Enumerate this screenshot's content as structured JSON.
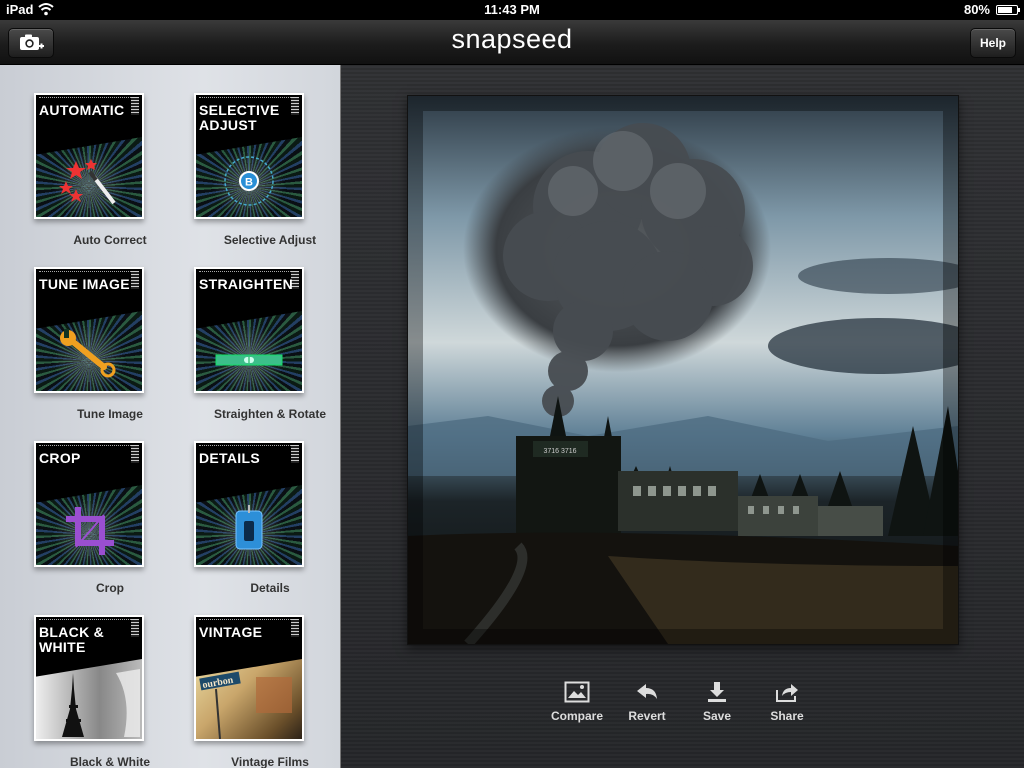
{
  "status": {
    "carrier": "iPad",
    "time": "11:43 PM",
    "battery_pct": "80%",
    "battery_level": 0.8
  },
  "nav": {
    "logo": "snapseed",
    "help_label": "Help"
  },
  "tools": [
    {
      "tile": "AUTOMATIC",
      "label": "Auto Correct",
      "icon": "magic-wand-icon"
    },
    {
      "tile": "SELECTIVE\nADJUST",
      "label": "Selective Adjust",
      "icon": "control-point-icon"
    },
    {
      "tile": "TUNE IMAGE",
      "label": "Tune Image",
      "icon": "wrench-icon"
    },
    {
      "tile": "STRAIGHTEN",
      "label": "Straighten & Rotate",
      "icon": "level-icon"
    },
    {
      "tile": "CROP",
      "label": "Crop",
      "icon": "crop-icon"
    },
    {
      "tile": "DETAILS",
      "label": "Details",
      "icon": "sharpener-icon"
    },
    {
      "tile": "BLACK &\nWHITE",
      "label": "Black & White",
      "icon": "eiffel-tower-image"
    },
    {
      "tile": "VINTAGE",
      "label": "Vintage Films",
      "icon": "vintage-street-image"
    }
  ],
  "toolbar": {
    "compare": "Compare",
    "revert": "Revert",
    "save": "Save",
    "share": "Share"
  },
  "selective_marker": "B",
  "sign_text": "ourbon",
  "train_number": "3716 3716"
}
